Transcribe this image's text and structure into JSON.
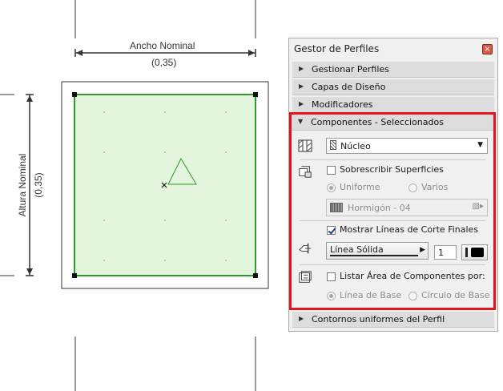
{
  "drawing": {
    "width_label": "Ancho Nominal",
    "width_value": "(0,35)",
    "height_label": "Altura Nominal",
    "height_value": "(0,35)"
  },
  "panel": {
    "title": "Gestor de Perfiles",
    "close_symbol": "×",
    "sections": [
      {
        "label": "Gestionar Perfiles"
      },
      {
        "label": "Capas de Diseño"
      },
      {
        "label": "Modificadores"
      }
    ],
    "components": {
      "header": "Componentes - Seleccionados",
      "component_select": "Núcleo",
      "override_surfaces": {
        "label": "Sobrescribir Superficies",
        "checked": false
      },
      "surface_mode": {
        "uniform": "Uniforme",
        "various": "Varios",
        "selected": "uniform"
      },
      "surface_material": "Hormigón - 04",
      "show_cut_lines": {
        "label": "Mostrar Líneas de Corte Finales",
        "checked": true
      },
      "line_type": "Línea Sólida",
      "pen_number": "1",
      "pen_color": "#000000",
      "list_area": {
        "label": "Listar Área de Componentes por:",
        "checked": false
      },
      "area_mode": {
        "base_line": "Línea de Base",
        "base_circle": "Círculo de Base",
        "selected": "base_line"
      }
    },
    "bottom_section": "Contornos uniformes del Perfil"
  },
  "colors": {
    "highlight_border": "#e0161b",
    "fill_green": "#e3f5dc",
    "outline_green": "#2e9a2e"
  },
  "icons": [
    "triangle-marker-icon",
    "close-icon",
    "component-pattern-icon",
    "surface-icon",
    "line-icon",
    "area-icon",
    "hatch-swatch-icon",
    "dropdown-arrow-icon"
  ]
}
